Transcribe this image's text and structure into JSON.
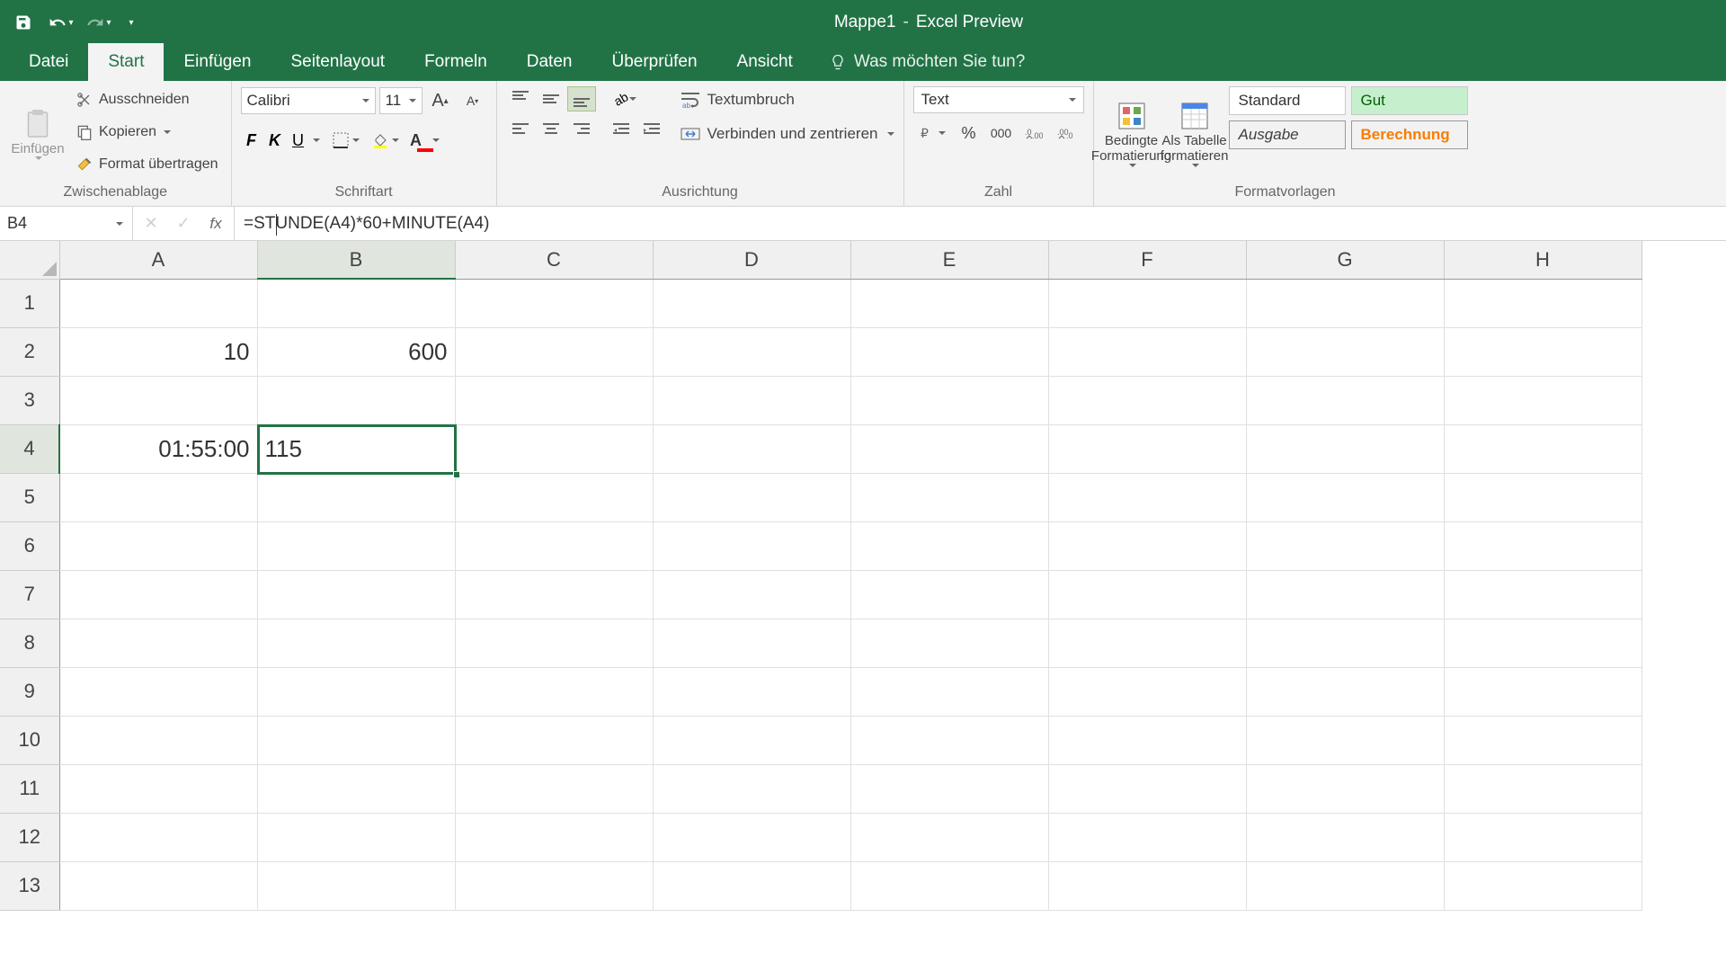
{
  "title": {
    "workbook": "Mappe1",
    "app": "Excel Preview"
  },
  "tabs": [
    "Datei",
    "Start",
    "Einfügen",
    "Seitenlayout",
    "Formeln",
    "Daten",
    "Überprüfen",
    "Ansicht"
  ],
  "active_tab": "Start",
  "tell_me": "Was möchten Sie tun?",
  "ribbon": {
    "clipboard": {
      "paste": "Einfügen",
      "cut": "Ausschneiden",
      "copy": "Kopieren",
      "painter": "Format übertragen",
      "label": "Zwischenablage"
    },
    "font": {
      "name": "Calibri",
      "size": "11",
      "B": "F",
      "I": "K",
      "U": "U",
      "label": "Schriftart"
    },
    "alignment": {
      "wrap": "Textumbruch",
      "merge": "Verbinden und zentrieren",
      "label": "Ausrichtung"
    },
    "number": {
      "format": "Text",
      "label": "Zahl"
    },
    "cond_format": "Bedingte Formatierung",
    "table_format": "Als Tabelle formatieren",
    "styles": {
      "standard": "Standard",
      "gut": "Gut",
      "ausgabe": "Ausgabe",
      "berechnung": "Berechnung",
      "label": "Formatvorlagen"
    }
  },
  "name_box": "B4",
  "formula": "=STUNDE(A4)*60+MINUTE(A4)",
  "columns": [
    "A",
    "B",
    "C",
    "D",
    "E",
    "F",
    "G",
    "H"
  ],
  "rows": [
    "1",
    "2",
    "3",
    "4",
    "5",
    "6",
    "7",
    "8",
    "9",
    "10",
    "11",
    "12",
    "13"
  ],
  "cells": {
    "A2": {
      "value": "10",
      "align": "ra"
    },
    "B2": {
      "value": "600",
      "align": "ra"
    },
    "A4": {
      "value": "01:55:00",
      "align": "ra"
    },
    "B4": {
      "value": "115",
      "align": "la"
    }
  },
  "selection": {
    "cell": "B4",
    "col_index": 1,
    "row_index": 3
  }
}
